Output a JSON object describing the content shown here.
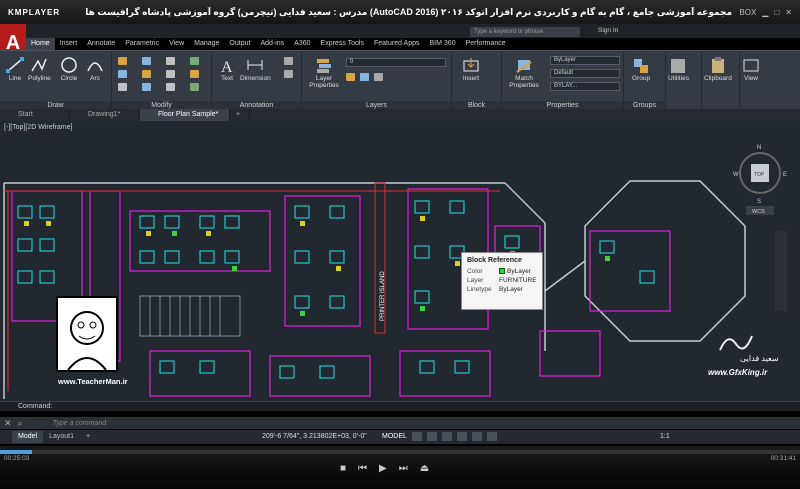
{
  "player": {
    "logo": "KMPLAYER",
    "title": "مجموعه آموزشی جامع ، گام به گام و کاربردی نرم افزار اتوکد ۲۰۱۶ (AutoCAD 2016) مدرس : سعید فدایی (تیچرمن) گروه آموزشی پادشاه گرافیست ها",
    "ctrl_box": "BOX",
    "time_elapsed": "00:25:03",
    "time_total": "00:31:41",
    "progress": 0.04
  },
  "acad": {
    "app_letter": "A",
    "search_placeholder": "Type a keyword or phrase",
    "sign_in": "Sign In"
  },
  "ribbon_tabs": [
    "Home",
    "Insert",
    "Annotate",
    "Parametric",
    "View",
    "Manage",
    "Output",
    "Add-ins",
    "A360",
    "Express Tools",
    "Featured Apps",
    "BIM 360",
    "Performance"
  ],
  "panels": {
    "draw": {
      "title": "Draw",
      "tools": [
        "Line",
        "Polyline",
        "Circle",
        "Arc"
      ]
    },
    "modify": {
      "title": "Modify"
    },
    "annotation": {
      "title": "Annotation",
      "tools": [
        "Text",
        "Dimension"
      ]
    },
    "layers": {
      "title": "Layers",
      "tool": "Layer Properties",
      "layer_value": "0"
    },
    "block": {
      "title": "Block",
      "tool": "Insert"
    },
    "properties": {
      "title": "Properties",
      "tool": "Match Properties",
      "color": "ByLayer",
      "linetype": "Default",
      "lineweight": "BYLAY..."
    },
    "groups": {
      "title": "Groups",
      "tool": "Group"
    },
    "utilities": {
      "tool": "Utilities"
    },
    "clipboard": {
      "tool": "Clipboard"
    },
    "view": {
      "tool": "View"
    }
  },
  "file_tabs": [
    "Start",
    "Drawing1*",
    "Floor Plan Sample*"
  ],
  "viewport_label": "[-][Top][2D Wireframe]",
  "drawing_text": {
    "printer_island": "PRINTER ISLAND"
  },
  "viewcube": {
    "top": "TOP",
    "n": "N",
    "s": "S",
    "e": "E",
    "w": "W",
    "wcs": "WCS"
  },
  "tooltip": {
    "title": "Block Reference",
    "rows": [
      {
        "k": "Color",
        "v": "ByLayer"
      },
      {
        "k": "Layer",
        "v": "FURNITURE"
      },
      {
        "k": "Linetype",
        "v": "ByLayer"
      }
    ]
  },
  "watermarks": {
    "left_url": "www.TeacherMan.ir",
    "right_name": "سعید فدایی",
    "right_url": "www.GfxKing.ir"
  },
  "command": {
    "history": "Command:",
    "placeholder": "Type a command"
  },
  "status": {
    "layout_tabs": [
      "Model",
      "Layout1"
    ],
    "coords": "209'-6 7/64\", 3.213802E+03, 0'-0\"",
    "space": "MODEL",
    "scale": "1:1"
  },
  "colors": {
    "accent": "#b71c1c",
    "cad_bg": "#212830",
    "ribbon": "#353b44"
  }
}
